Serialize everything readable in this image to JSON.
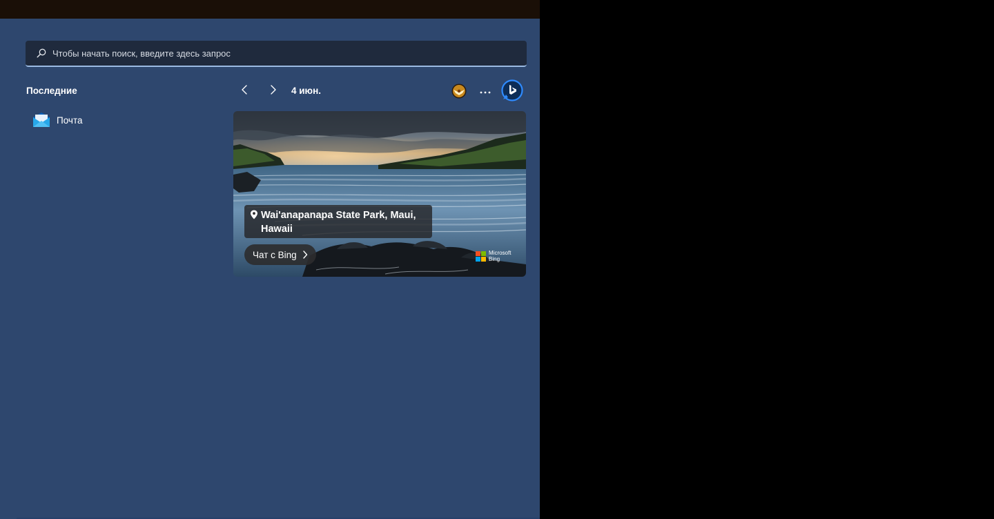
{
  "search": {
    "placeholder": "Чтобы начать поиск, введите здесь запрос"
  },
  "recent": {
    "title": "Последние",
    "items": [
      {
        "label": "Почта",
        "icon": "mail-icon"
      }
    ]
  },
  "spotlight": {
    "date": "4 июн.",
    "location_line1": "Wai'anapanapa State Park, Maui,",
    "location_line2": "Hawaii",
    "chat_label": "Чат с Bing",
    "brand_line1": "Microsoft",
    "brand_line2": "Bing"
  },
  "icons": {
    "search": "search-icon",
    "prev": "chevron-left-icon",
    "next": "chevron-right-icon",
    "badge": "achievement-badge-icon",
    "more": "more-dots-icon",
    "bing": "bing-chat-icon",
    "pin": "location-pin-icon"
  },
  "colors": {
    "panel": "#2e476e",
    "search_bg": "#1f2a3d",
    "search_underline": "#9bbbe3",
    "bing_blue": "#1d6ff2"
  }
}
